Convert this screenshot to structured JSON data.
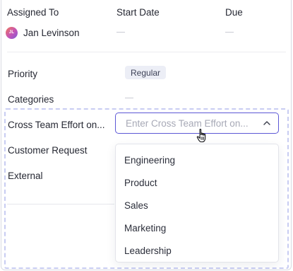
{
  "header": {
    "assigned_to": "Assigned To",
    "start_date": "Start Date",
    "due": "Due"
  },
  "assignee": {
    "initials": "JL",
    "name": "Jan Levinson"
  },
  "fields": {
    "priority_label": "Priority",
    "priority_value": "Regular",
    "categories_label": "Categories",
    "cross_team_label": "Cross Team Effort on...",
    "customer_request_label": "Customer Request",
    "external_label": "External"
  },
  "select": {
    "placeholder": "Enter Cross Team Effort on..."
  },
  "menu": {
    "options": [
      "Engineering",
      "Product",
      "Sales",
      "Marketing",
      "Leadership"
    ]
  },
  "icons": {
    "chevron": "chevron-up-icon",
    "cursor": "hand-pointer-icon"
  },
  "colors": {
    "accent": "#5d58d6",
    "badge_bg": "#eceef6",
    "dashed_outline": "#c8ccf2"
  }
}
